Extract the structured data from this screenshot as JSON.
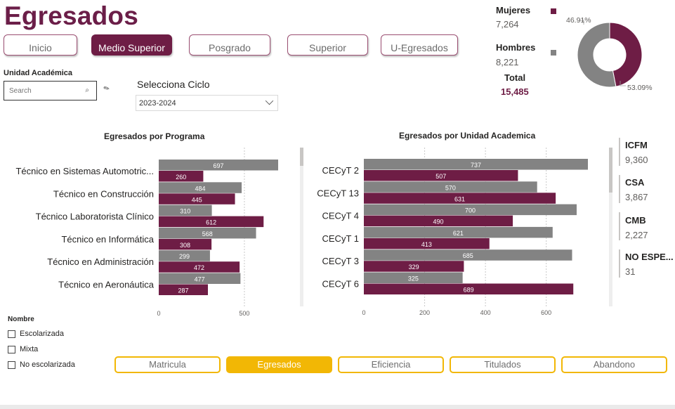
{
  "title": "Egresados",
  "nav": [
    {
      "label": "Inicio",
      "active": false
    },
    {
      "label": "Medio Superior",
      "active": true
    },
    {
      "label": "Posgrado",
      "active": false
    },
    {
      "label": "Superior",
      "active": false
    },
    {
      "label": "U-Egresados",
      "active": false
    }
  ],
  "filters": {
    "unidad_label": "Unidad Académica",
    "search_placeholder": "Search",
    "ciclo_label": "Selecciona Ciclo",
    "ciclo_value": "2023-2024"
  },
  "gender": {
    "mujeres_label": "Mujeres",
    "mujeres_value": "7,264",
    "hombres_label": "Hombres",
    "hombres_value": "8,221",
    "total_label": "Total",
    "total_value": "15,485",
    "mujeres_pct": "46.91%",
    "hombres_pct": "53.09%"
  },
  "colors": {
    "maroon": "#6e1d45",
    "gray": "#838383",
    "gold": "#f2b705"
  },
  "chart_data": [
    {
      "type": "bar",
      "orientation": "horizontal",
      "title": "Egresados por Programa",
      "categories": [
        "Técnico en Sistemas Automotric...",
        "Técnico en Construcción",
        "Técnico Laboratorista Clínico",
        "Técnico en Informática",
        "Técnico en Administración",
        "Técnico en Aeronáutica"
      ],
      "series": [
        {
          "color": "#838383",
          "values": [
            697,
            484,
            310,
            568,
            299,
            477
          ]
        },
        {
          "color": "#6e1d45",
          "values": [
            260,
            445,
            612,
            308,
            472,
            287
          ]
        }
      ],
      "xticks": [
        0,
        500
      ],
      "xlim": [
        0,
        700
      ],
      "grid": true
    },
    {
      "type": "bar",
      "orientation": "horizontal",
      "title": "Egresados por Unidad Academica",
      "categories": [
        "CECyT 2",
        "CECyT 13",
        "CECyT 4",
        "CECyT 1",
        "CECyT 3",
        "CECyT 6"
      ],
      "series": [
        {
          "color": "#838383",
          "values": [
            737,
            570,
            700,
            621,
            685,
            325
          ]
        },
        {
          "color": "#6e1d45",
          "values": [
            507,
            631,
            490,
            413,
            329,
            689
          ]
        }
      ],
      "xticks": [
        0,
        200,
        400,
        600
      ],
      "xlim": [
        0,
        740
      ],
      "grid": true
    },
    {
      "type": "pie",
      "donut": true,
      "labels": [
        "46.91%",
        "53.09%"
      ],
      "values": [
        46.91,
        53.09
      ],
      "colors": [
        "#6e1d45",
        "#838383"
      ]
    }
  ],
  "kpis": [
    {
      "label": "ICFM",
      "value": "9,360"
    },
    {
      "label": "CSA",
      "value": "3,867"
    },
    {
      "label": "CMB",
      "value": "2,227"
    },
    {
      "label": "NO ESPE...",
      "value": "31"
    }
  ],
  "nombre_filter": {
    "title": "Nombre",
    "options": [
      "Escolarizada",
      "Mixta",
      "No escolarizada"
    ]
  },
  "bottom_nav": [
    {
      "label": "Matricula",
      "active": false
    },
    {
      "label": "Egresados",
      "active": true
    },
    {
      "label": "Eficiencia",
      "active": false
    },
    {
      "label": "Titulados",
      "active": false
    },
    {
      "label": "Abandono",
      "active": false
    }
  ]
}
